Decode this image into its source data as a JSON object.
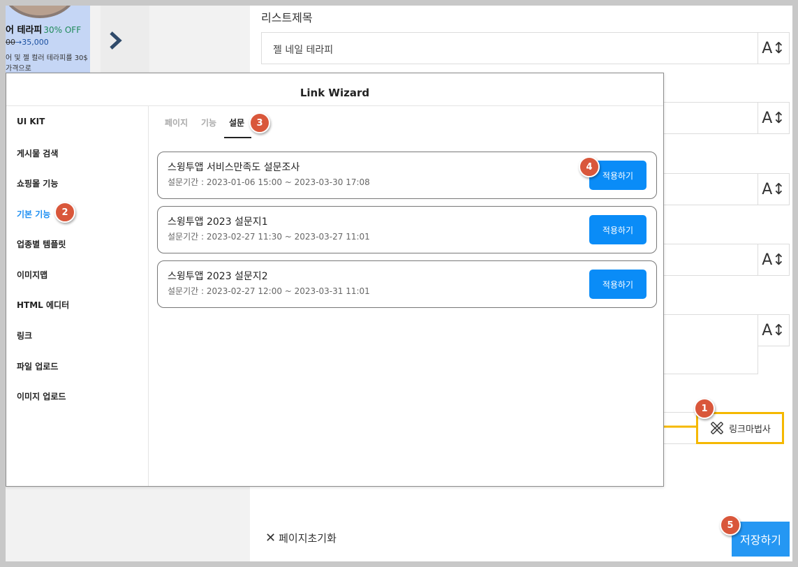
{
  "background": {
    "promo": {
      "title": "어 테라피",
      "discount": "30% OFF",
      "old_price": "00",
      "new_price": "35,000",
      "desc_line1": "어 및 젤 컬러 테라피를 30$",
      "desc_line2": "가격으로"
    },
    "list_title_label": "리스트제목",
    "list_title_value": "젤 네일 테라피",
    "font_size_icon_label": "A↕",
    "link_wizard_button": "링크마법사",
    "reset_button": "페이지초기화",
    "save_button": "저장하기"
  },
  "modal": {
    "title": "Link Wizard",
    "sidebar": [
      {
        "label": "UI KIT"
      },
      {
        "label": "게시물 검색"
      },
      {
        "label": "쇼핑몰 기능"
      },
      {
        "label": "기본 기능"
      },
      {
        "label": "업종별 템플릿"
      },
      {
        "label": "이미지맵"
      },
      {
        "label": "HTML 에디터"
      },
      {
        "label": "링크"
      },
      {
        "label": "파일 업로드"
      },
      {
        "label": "이미지 업로드"
      }
    ],
    "active_sidebar": "기본 기능",
    "tabs": [
      {
        "label": "페이지"
      },
      {
        "label": "기능"
      },
      {
        "label": "설문"
      }
    ],
    "active_tab": "설문",
    "surveys": [
      {
        "title": "스윙투앱 서비스만족도 설문조사",
        "period": "설문기간 : 2023-01-06 15:00 ~ 2023-03-30 17:08",
        "action": "적용하기"
      },
      {
        "title": "스윙투앱 2023 설문지1",
        "period": "설문기간 : 2023-02-27 11:30 ~ 2023-03-27 11:01",
        "action": "적용하기"
      },
      {
        "title": "스윙투앱 2023 설문지2",
        "period": "설문기간 : 2023-02-27 12:00 ~ 2023-03-31 11:01",
        "action": "적용하기"
      }
    ]
  },
  "step_badges": [
    "1",
    "2",
    "3",
    "4",
    "5"
  ],
  "colors": {
    "accent_blue": "#0a8cf7",
    "save_blue": "#2597f3",
    "highlight_yellow": "#f5b800",
    "badge_red": "#d9573b",
    "active_sidebar_blue": "#1e8ff2"
  }
}
